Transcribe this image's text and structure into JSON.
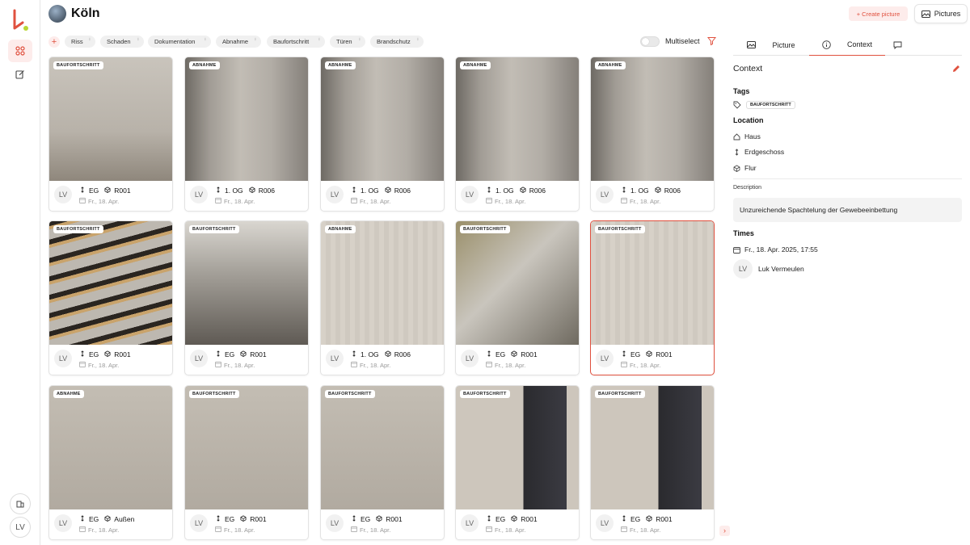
{
  "header": {
    "title": "Köln",
    "create_label": "+ Create picture",
    "pictures_label": "Pictures"
  },
  "rail": {
    "user_initials": "LV"
  },
  "filters": {
    "chips": [
      "Riss",
      "Schaden",
      "Dokumentation",
      "Abnahme",
      "Baufortschritt",
      "Türen",
      "Brandschutz"
    ],
    "multiselect_label": "Multiselect",
    "multiselect_on": false
  },
  "cards": [
    {
      "badge": "BAUFORTSCHRITT",
      "floor": "EG",
      "room": "R001",
      "date": "Fr., 18. Apr.",
      "initials": "LV",
      "photo": "p-concrete"
    },
    {
      "badge": "ABNAHME",
      "floor": "1. OG",
      "room": "R006",
      "date": "Fr., 18. Apr.",
      "initials": "LV",
      "photo": "p-drywall"
    },
    {
      "badge": "ABNAHME",
      "floor": "1. OG",
      "room": "R006",
      "date": "Fr., 18. Apr.",
      "initials": "LV",
      "photo": "p-drywall"
    },
    {
      "badge": "ABNAHME",
      "floor": "1. OG",
      "room": "R006",
      "date": "Fr., 18. Apr.",
      "initials": "LV",
      "photo": "p-drywall"
    },
    {
      "badge": "ABNAHME",
      "floor": "1. OG",
      "room": "R006",
      "date": "Fr., 18. Apr.",
      "initials": "LV",
      "photo": "p-drywall"
    },
    {
      "badge": "BAUFORTSCHRITT",
      "floor": "EG",
      "room": "R001",
      "date": "Fr., 18. Apr.",
      "initials": "LV",
      "photo": "p-stairs"
    },
    {
      "badge": "BAUFORTSCHRITT",
      "floor": "EG",
      "room": "R001",
      "date": "Fr., 18. Apr.",
      "initials": "LV",
      "photo": "p-dark"
    },
    {
      "badge": "ABNAHME",
      "floor": "1. OG",
      "room": "R006",
      "date": "Fr., 18. Apr.",
      "initials": "LV",
      "photo": "p-plaster"
    },
    {
      "badge": "BAUFORTSCHRITT",
      "floor": "EG",
      "room": "R001",
      "date": "Fr., 18. Apr.",
      "initials": "LV",
      "photo": "p-ground"
    },
    {
      "badge": "BAUFORTSCHRITT",
      "floor": "EG",
      "room": "R001",
      "date": "Fr., 18. Apr.",
      "initials": "LV",
      "photo": "p-plaster",
      "selected": true
    },
    {
      "badge": "ABNAHME",
      "floor": "EG",
      "room": "Außen",
      "date": "Fr., 18. Apr.",
      "initials": "LV",
      "photo": "p-facade"
    },
    {
      "badge": "BAUFORTSCHRITT",
      "floor": "EG",
      "room": "R001",
      "date": "Fr., 18. Apr.",
      "initials": "LV",
      "photo": "p-facade"
    },
    {
      "badge": "BAUFORTSCHRITT",
      "floor": "EG",
      "room": "R001",
      "date": "Fr., 18. Apr.",
      "initials": "LV",
      "photo": "p-facade"
    },
    {
      "badge": "BAUFORTSCHRITT",
      "floor": "EG",
      "room": "R001",
      "date": "Fr., 18. Apr.",
      "initials": "LV",
      "photo": "p-door"
    },
    {
      "badge": "BAUFORTSCHRITT",
      "floor": "EG",
      "room": "R001",
      "date": "Fr., 18. Apr.",
      "initials": "LV",
      "photo": "p-door"
    }
  ],
  "panel": {
    "tabs": [
      "Picture",
      "Context",
      ""
    ],
    "active_tab": "Context",
    "context_title": "Context",
    "tags_heading": "Tags",
    "tag": "BAUFORTSCHRITT",
    "location_heading": "Location",
    "building": "Haus",
    "floor": "Erdgeschoss",
    "room": "Flur",
    "description_label": "Description",
    "description": "Unzureichende Spachtelung der Gewebeeinbettung",
    "times_heading": "Times",
    "timestamp": "Fr., 18. Apr. 2025, 17:55",
    "user_initials": "LV",
    "user_name": "Luk Vermeulen"
  },
  "colors": {
    "accent": "#e0513f",
    "accent_light": "#fdeceb"
  }
}
